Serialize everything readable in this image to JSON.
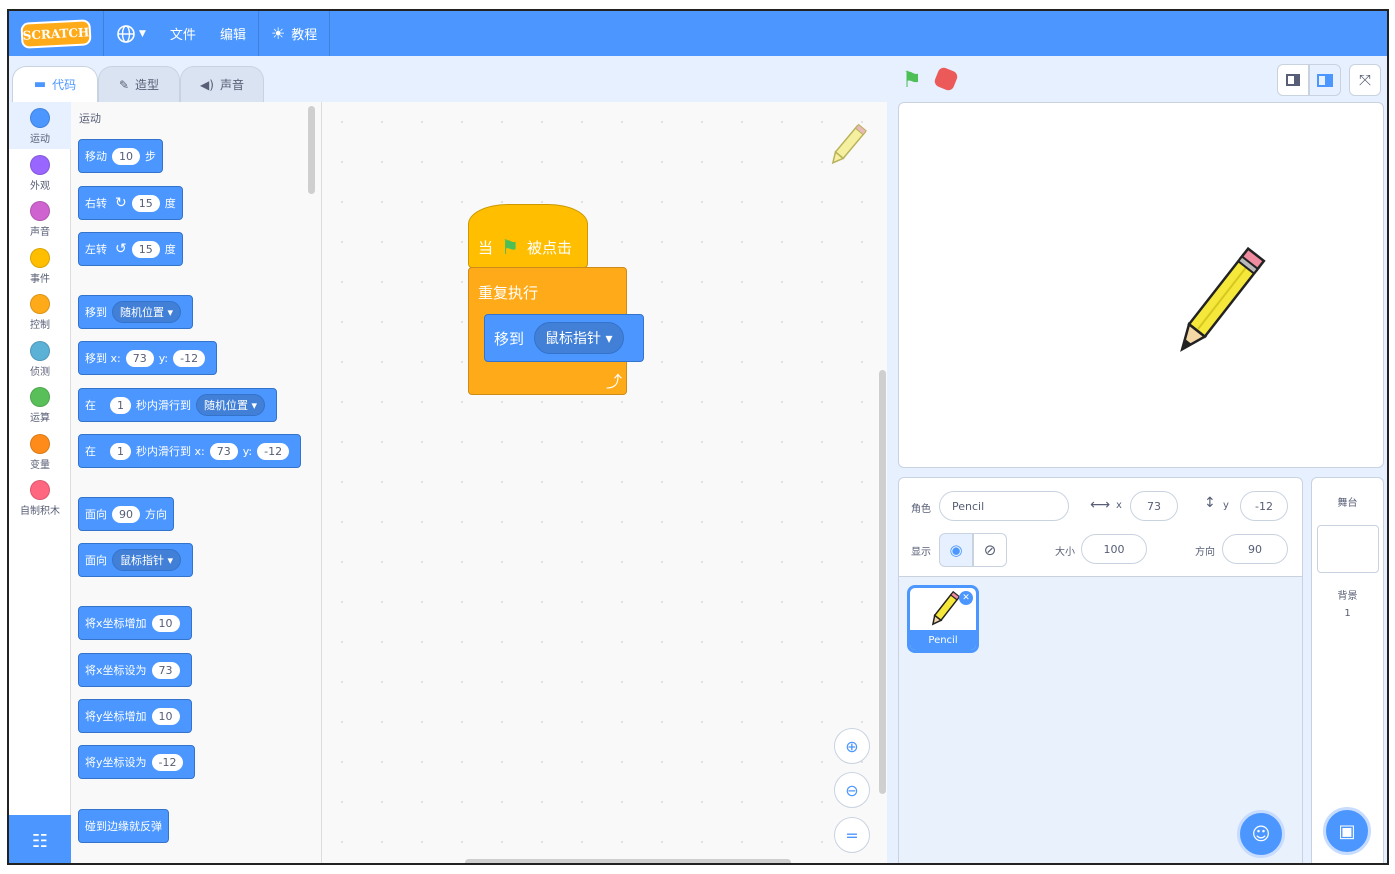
{
  "menu": {
    "logo_text": "SCRATCH",
    "file": "文件",
    "edit": "编辑",
    "tutorials": "教程"
  },
  "tabs": {
    "code": "代码",
    "costumes": "造型",
    "sounds": "声音"
  },
  "categories": [
    {
      "label": "运动",
      "color": "#4c97ff"
    },
    {
      "label": "外观",
      "color": "#9966ff"
    },
    {
      "label": "声音",
      "color": "#cf63cf"
    },
    {
      "label": "事件",
      "color": "#ffbf00"
    },
    {
      "label": "控制",
      "color": "#ffab19"
    },
    {
      "label": "侦测",
      "color": "#5cb1d6"
    },
    {
      "label": "运算",
      "color": "#59c059"
    },
    {
      "label": "变量",
      "color": "#ff8c1a"
    },
    {
      "label": "自制积木",
      "color": "#ff6680"
    }
  ],
  "palette": {
    "heading": "运动",
    "move": {
      "a": "移动",
      "v": "10",
      "b": "步"
    },
    "turn_right": {
      "a": "右转",
      "v": "15",
      "b": "度"
    },
    "turn_left": {
      "a": "左转",
      "v": "15",
      "b": "度"
    },
    "goto": {
      "a": "移到",
      "dd": "随机位置"
    },
    "goto_xy": {
      "a": "移到 x:",
      "x": "73",
      "b": "y:",
      "y": "-12"
    },
    "glide": {
      "a": "在",
      "v": "1",
      "b": "秒内滑行到",
      "dd": "随机位置"
    },
    "glide_xy": {
      "a": "在",
      "v": "1",
      "b": "秒内滑行到 x:",
      "x": "73",
      "c": "y:",
      "y": "-12"
    },
    "point_dir": {
      "a": "面向",
      "v": "90",
      "b": "方向"
    },
    "point_towards": {
      "a": "面向",
      "dd": "鼠标指针"
    },
    "change_x": {
      "a": "将x坐标增加",
      "v": "10"
    },
    "set_x": {
      "a": "将x坐标设为",
      "v": "73"
    },
    "change_y": {
      "a": "将y坐标增加",
      "v": "10"
    },
    "set_y": {
      "a": "将y坐标设为",
      "v": "-12"
    },
    "bounce": "碰到边缘就反弹"
  },
  "script": {
    "hat_a": "当",
    "hat_b": "被点击",
    "forever": "重复执行",
    "goto_label": "移到",
    "goto_target": "鼠标指针"
  },
  "sprite_info": {
    "sprite_label": "角色",
    "sprite_name": "Pencil",
    "x_label": "x",
    "x_value": "73",
    "y_label": "y",
    "y_value": "-12",
    "show_label": "显示",
    "size_label": "大小",
    "size_value": "100",
    "direction_label": "方向",
    "direction_value": "90"
  },
  "sprites": [
    {
      "name": "Pencil"
    }
  ],
  "stage_panel": {
    "title": "舞台",
    "backdrops_label": "背景",
    "backdrops_count": "1"
  },
  "colors": {
    "motion": "#4c97ff",
    "events": "#ffbf00",
    "control": "#ffab19",
    "menu": "#4c97ff"
  }
}
